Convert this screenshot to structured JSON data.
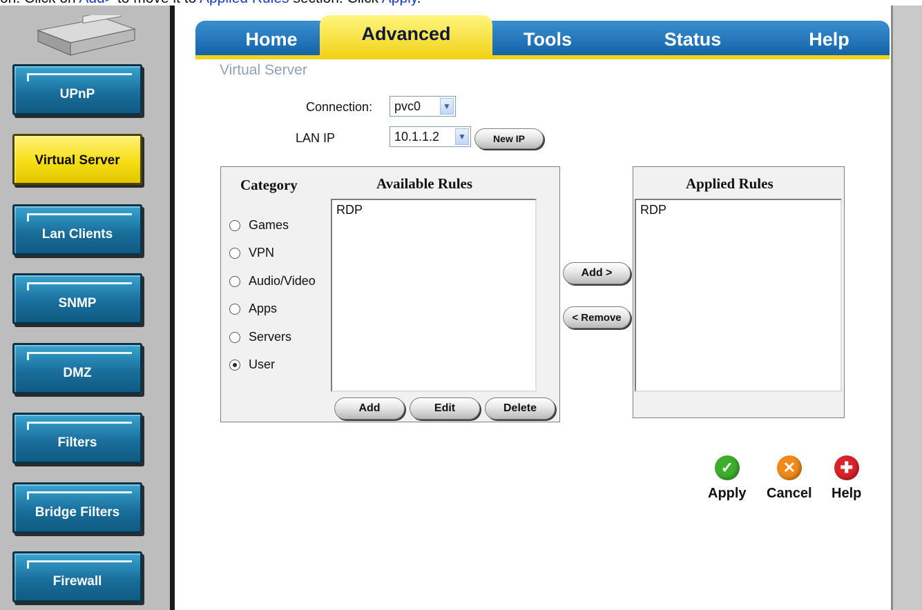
{
  "caption": {
    "part1": "on. Click on ",
    "add_word": "Add>",
    "part2": " to move it to ",
    "applied_word": "Applied Rules",
    "part3": " section. Click ",
    "apply_word": "Apply",
    "part4": "."
  },
  "sidebar": {
    "items": [
      {
        "label": "UPnP"
      },
      {
        "label": "Virtual Server",
        "active": true
      },
      {
        "label": "Lan Clients"
      },
      {
        "label": "SNMP"
      },
      {
        "label": "DMZ"
      },
      {
        "label": "Filters"
      },
      {
        "label": "Bridge Filters"
      },
      {
        "label": "Firewall"
      }
    ]
  },
  "tabs": [
    {
      "label": "Home"
    },
    {
      "label": "Advanced",
      "active": true
    },
    {
      "label": "Tools"
    },
    {
      "label": "Status"
    },
    {
      "label": "Help"
    }
  ],
  "page": {
    "title": "Virtual Server",
    "connection_label": "Connection:",
    "connection_value": "pvc0",
    "lan_ip_label": "LAN IP",
    "lan_ip_value": "10.1.1.2",
    "new_ip_button": "New IP"
  },
  "rules_panel": {
    "category_heading": "Category",
    "available_heading": "Available Rules",
    "categories": [
      "Games",
      "VPN",
      "Audio/Video",
      "Apps",
      "Servers",
      "User"
    ],
    "selected_category": "User",
    "available_rules": [
      "RDP"
    ],
    "add_button": "Add",
    "edit_button": "Edit",
    "delete_button": "Delete"
  },
  "transfer": {
    "add_button": "Add >",
    "remove_button": "< Remove"
  },
  "applied_panel": {
    "heading": "Applied Rules",
    "rules": [
      "RDP"
    ]
  },
  "actions": {
    "apply": "Apply",
    "cancel": "Cancel",
    "help": "Help",
    "apply_color": "#3cae2a",
    "cancel_color": "#ef8a1b",
    "help_color": "#d9222a"
  }
}
